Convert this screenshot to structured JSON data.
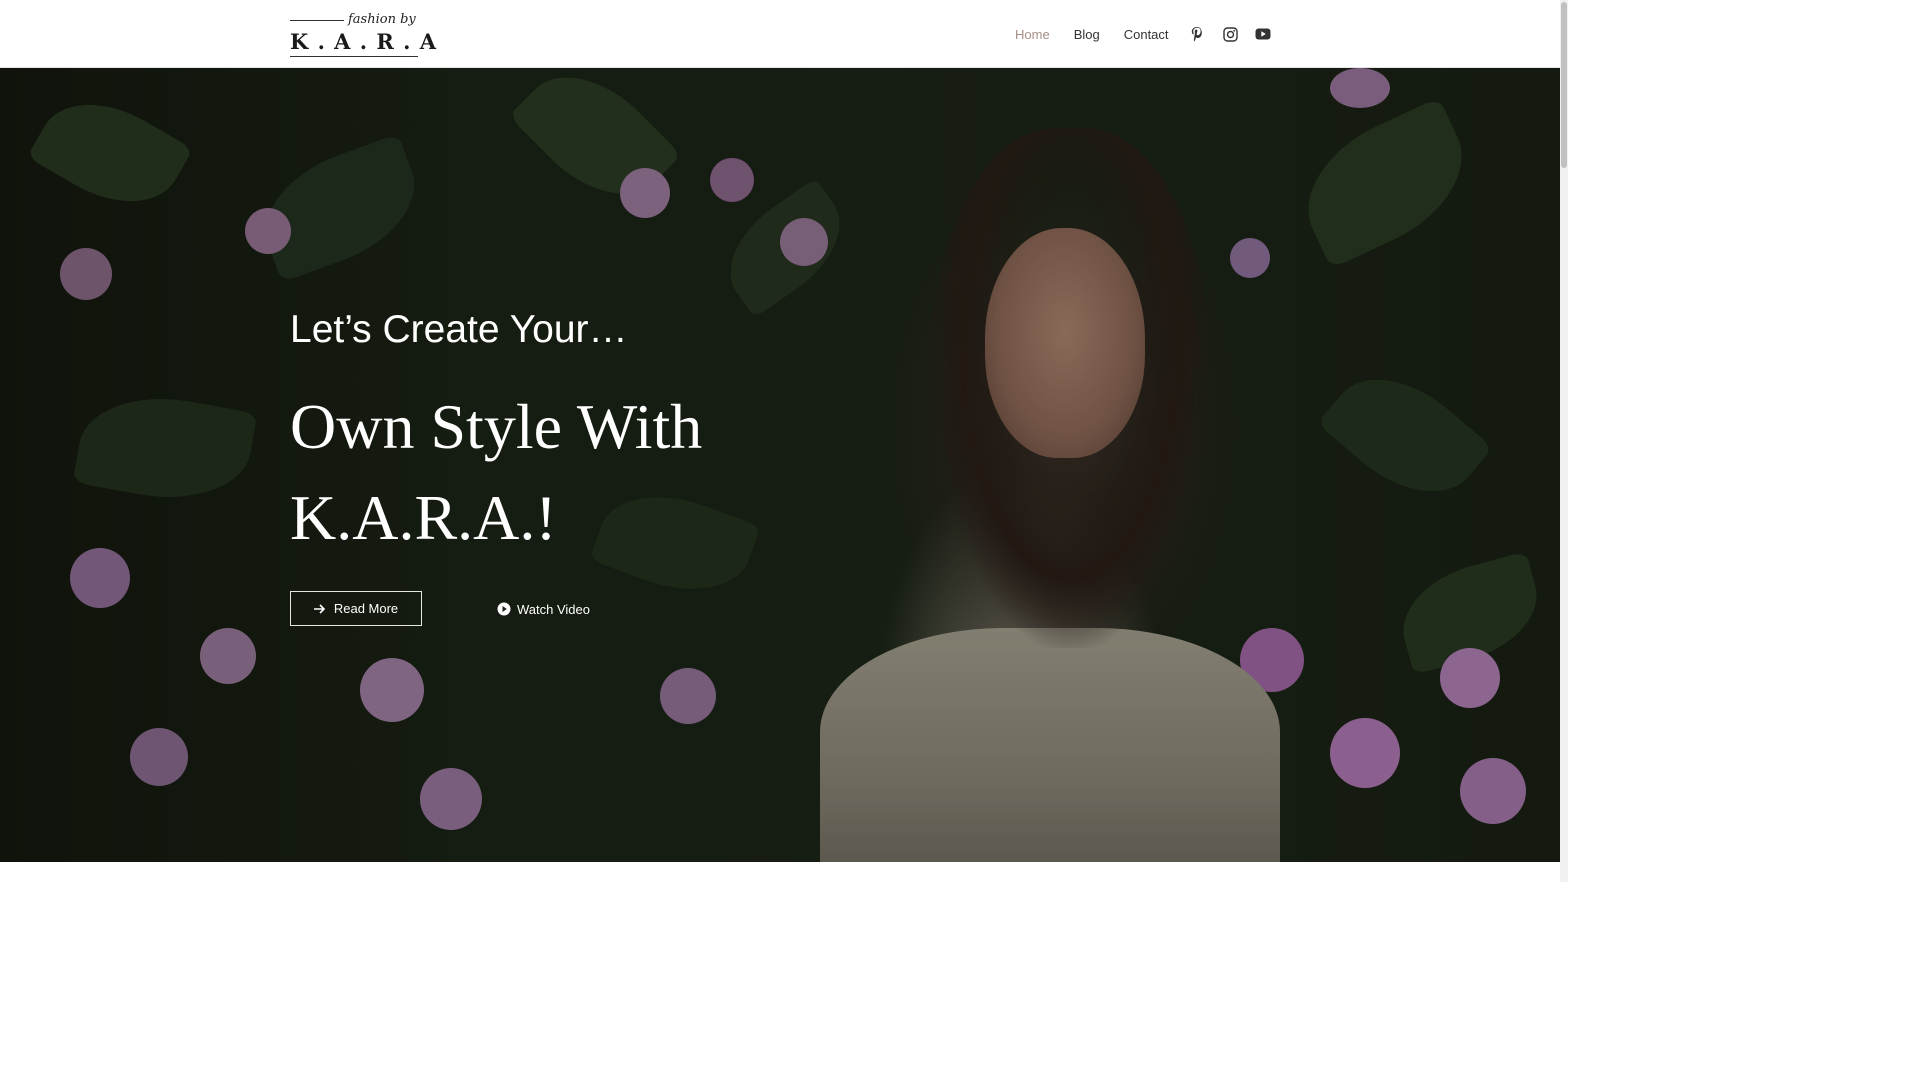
{
  "header": {
    "logo": {
      "script": "fashion by",
      "letters": "K . A . R . A"
    },
    "nav": [
      {
        "label": "Home",
        "active": true
      },
      {
        "label": "Blog",
        "active": false
      },
      {
        "label": "Contact",
        "active": false
      }
    ],
    "social": [
      "pinterest-icon",
      "instagram-icon",
      "youtube-icon"
    ]
  },
  "hero": {
    "subtitle": "Let’s Create Your…",
    "title_line1": "Own Style With",
    "title_line2": "K.A.R.A.!",
    "read_more_label": "Read More",
    "watch_video_label": "Watch Video"
  },
  "colors": {
    "nav_active": "#a78f86",
    "nav_text": "#333333",
    "hero_text": "#ffffff"
  }
}
